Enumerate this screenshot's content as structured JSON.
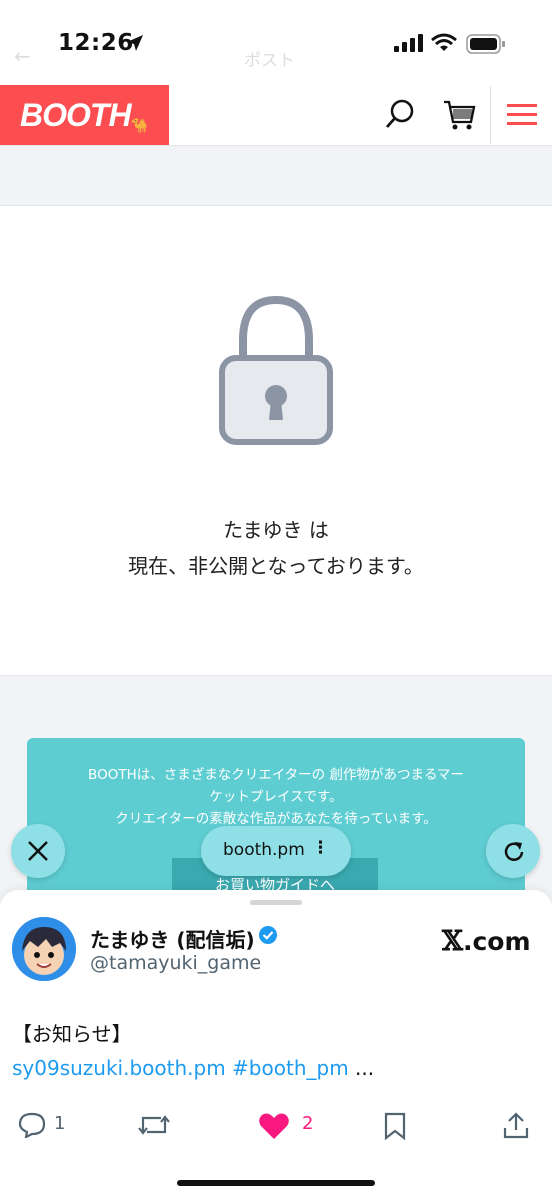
{
  "status_bar": {
    "time": "12:26",
    "ghost_back": "←",
    "ghost_title": "ポスト"
  },
  "booth_header": {
    "logo": "BOOTH",
    "logo_mark": "🐪"
  },
  "private_notice": {
    "line1": "たまゆき は",
    "line2": "現在、非公開となっております。"
  },
  "promo": {
    "line1": "BOOTHは、さまざまなクリエイターの 創作物があつまるマー",
    "line2": "ケットプレイスです。",
    "line3": "クリエイターの素敵な作品があなたを待っています。",
    "button": "お買い物ガイドへ"
  },
  "browser_controls": {
    "url": "booth.pm",
    "menu": "⋮"
  },
  "tweet": {
    "display_name": "たまゆき (配信垢)",
    "handle": "@tamayuki_game",
    "site": "𝕏.com",
    "site_x": "𝕏",
    "site_rest": ".com",
    "text_line1": "【お知らせ】",
    "text_link": "sy09suzuki.booth.pm #booth_pm",
    "text_more": " ...",
    "replies": "1",
    "likes": "2"
  },
  "colors": {
    "booth_red": "#fc4d50",
    "teal": "#5ecdd2",
    "pill": "#8fe0e6",
    "x_blue": "#1d9bf0",
    "like_pink": "#f91880"
  }
}
